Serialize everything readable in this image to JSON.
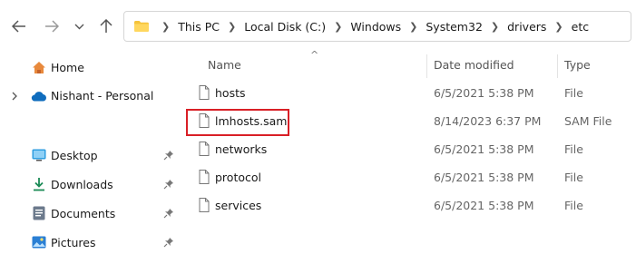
{
  "toolbar": {
    "back_icon": "arrow-left-icon",
    "forward_icon": "arrow-right-icon",
    "recent_icon": "chevron-down-icon",
    "up_icon": "arrow-up-icon"
  },
  "address_bar": {
    "folder_icon": "folder-icon",
    "breadcrumbs": [
      "This PC",
      "Local Disk (C:)",
      "Windows",
      "System32",
      "drivers",
      "etc"
    ]
  },
  "sidebar": {
    "home": "Home",
    "onedrive": "Nishant - Personal",
    "quick_access": [
      {
        "label": "Desktop",
        "icon": "desktop-icon"
      },
      {
        "label": "Downloads",
        "icon": "download-icon"
      },
      {
        "label": "Documents",
        "icon": "documents-icon"
      },
      {
        "label": "Pictures",
        "icon": "pictures-icon"
      }
    ]
  },
  "file_list": {
    "columns": {
      "name": "Name",
      "date_modified": "Date modified",
      "type": "Type"
    },
    "sort_indicator": "^",
    "rows": [
      {
        "name": "hosts",
        "date_modified": "6/5/2021 5:38 PM",
        "type": "File"
      },
      {
        "name": "lmhosts.sam",
        "date_modified": "8/14/2023 6:37 PM",
        "type": "SAM File"
      },
      {
        "name": "networks",
        "date_modified": "6/5/2021 5:38 PM",
        "type": "File"
      },
      {
        "name": "protocol",
        "date_modified": "6/5/2021 5:38 PM",
        "type": "File"
      },
      {
        "name": "services",
        "date_modified": "6/5/2021 5:38 PM",
        "type": "File"
      }
    ],
    "highlight_color": "#d91f26"
  }
}
